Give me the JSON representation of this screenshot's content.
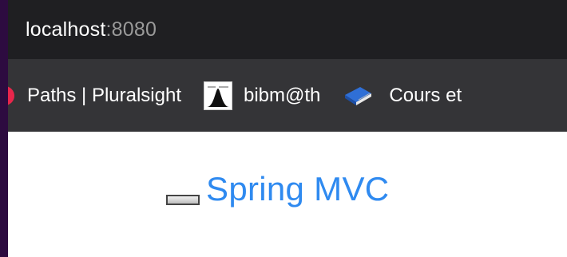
{
  "address_bar": {
    "host": "localhost",
    "port": ":8080"
  },
  "bookmarks": [
    {
      "label": "Paths | Pluralsight",
      "icon": "pluralsight-icon"
    },
    {
      "label": "bibm@th",
      "icon": "bibmath-icon"
    },
    {
      "label": "Cours et",
      "icon": "book-icon"
    }
  ],
  "page": {
    "title": "Spring MVC",
    "broken_image_icon": "broken-image-icon"
  },
  "colors": {
    "link": "#2f8af0",
    "address_bar_bg": "#1f1f22",
    "bookmarks_bar_bg": "#343437"
  }
}
